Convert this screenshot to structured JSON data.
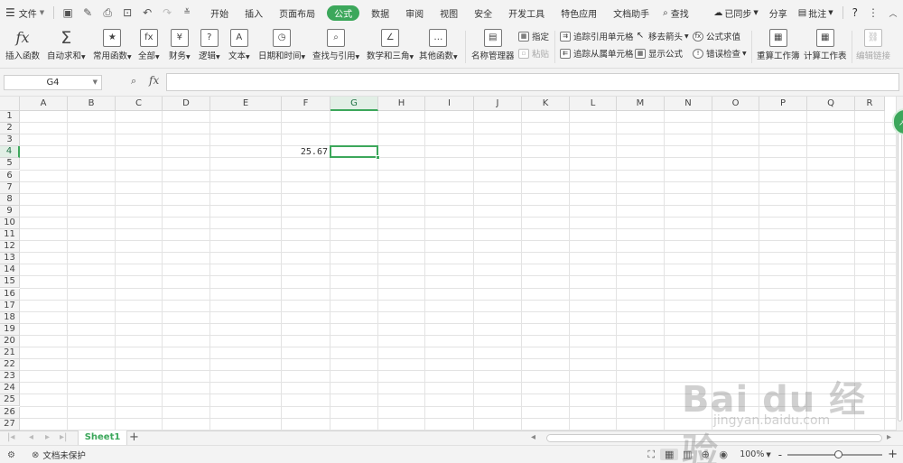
{
  "menubar": {
    "file": "文件",
    "tabs": [
      "开始",
      "插入",
      "页面布局",
      "公式",
      "数据",
      "审阅",
      "视图",
      "安全",
      "开发工具",
      "特色应用",
      "文档助手"
    ],
    "active_tab": "公式",
    "search": "查找",
    "sync": "已同步",
    "share": "分享",
    "comment": "批注",
    "help": "?"
  },
  "ribbon": {
    "insert_function": "插入函数",
    "autosum": "自动求和",
    "common_functions": "常用函数",
    "all": "全部",
    "financial": "财务",
    "logical": "逻辑",
    "text": "文本",
    "datetime": "日期和时间",
    "lookup": "查找与引用",
    "math": "数学和三角",
    "other_functions": "其他函数",
    "name_manager": "名称管理器",
    "assign": "指定",
    "paste": "粘贴",
    "trace_precedents": "追踪引用单元格",
    "trace_dependents": "追踪从属单元格",
    "remove_arrows": "移去箭头",
    "show_formulas": "显示公式",
    "evaluate_formula": "公式求值",
    "error_check": "错误检查",
    "recalc_workbook": "重算工作簿",
    "calc_sheet": "计算工作表",
    "edit_links": "编辑链接"
  },
  "formula_bar": {
    "name_box": "G4",
    "fx": "fx",
    "value": ""
  },
  "grid": {
    "columns": [
      "A",
      "B",
      "C",
      "D",
      "E",
      "F",
      "G",
      "H",
      "I",
      "J",
      "K",
      "L",
      "M",
      "N",
      "O",
      "P",
      "Q",
      "R"
    ],
    "rows": [
      "1",
      "2",
      "3",
      "4",
      "5",
      "6",
      "7",
      "8",
      "9",
      "10",
      "11",
      "12",
      "13",
      "14",
      "15",
      "16",
      "17",
      "18",
      "19",
      "20",
      "21",
      "22",
      "23",
      "24",
      "25",
      "26",
      "27"
    ],
    "selected_column": "G",
    "selected_row": "4",
    "cells": [
      {
        "ref": "F4",
        "value": "25.67"
      }
    ]
  },
  "sheets": {
    "tabs": [
      "Sheet1"
    ],
    "active": "Sheet1",
    "add": "+"
  },
  "statusbar": {
    "protection": "文档未保护",
    "zoom": "100%",
    "zoom_out": "-",
    "zoom_in": "+"
  },
  "watermark": {
    "text": "Bai du 经验",
    "url": "jingyan.baidu.com"
  }
}
